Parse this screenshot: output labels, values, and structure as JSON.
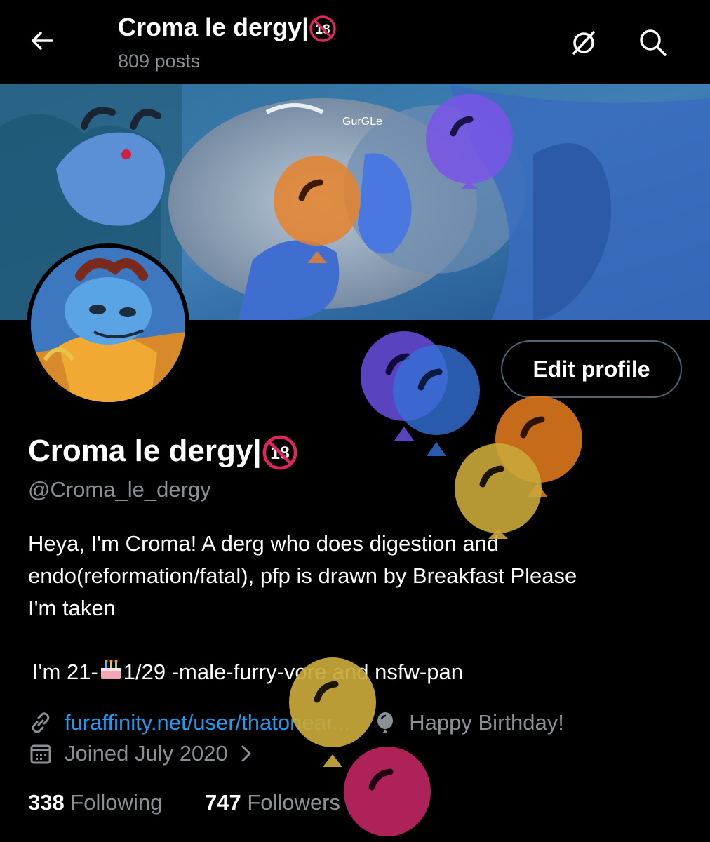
{
  "header": {
    "title": "Croma le dergy|",
    "post_count": "809 posts",
    "age_badge": "18"
  },
  "profile": {
    "display_name": "Croma le dergy|",
    "age_badge": "18",
    "handle": "@Croma_le_dergy",
    "edit_button": "Edit profile",
    "bio_lines": [
      "Heya, I'm Croma! A derg who does digestion and",
      "endo(reformation/fatal), pfp is drawn by Breakfast Please",
      "I'm taken"
    ],
    "bio_details_prefix": "I'm 21-",
    "bio_details_suffix": "1/29 -male-furry-vore and nsfw-pan",
    "website": "furaffinity.net/user/thatonear...",
    "birthday_note": "Happy Birthday!",
    "joined": "Joined July 2020",
    "following_count": "338",
    "following_label": "Following",
    "followers_count": "747",
    "followers_label": "Followers"
  },
  "banner_watermark": "GurGLe",
  "icons": {
    "back": "arrow-left-icon",
    "filter": "slashed-circle-icon",
    "search": "search-icon",
    "link": "link-icon",
    "balloon": "balloon-icon",
    "calendar": "calendar-icon",
    "chevron": "chevron-right-icon",
    "cake": "birthday-cake-icon"
  },
  "colors": {
    "background": "#000000",
    "link": "#1d9bf0",
    "muted": "#8b9096",
    "balloon_purple": "#6c4ee0",
    "balloon_blue": "#3b6bd6",
    "balloon_orange": "#e07a1c",
    "balloon_yellow": "#c9a93a",
    "balloon_magenta": "#c2246e"
  }
}
